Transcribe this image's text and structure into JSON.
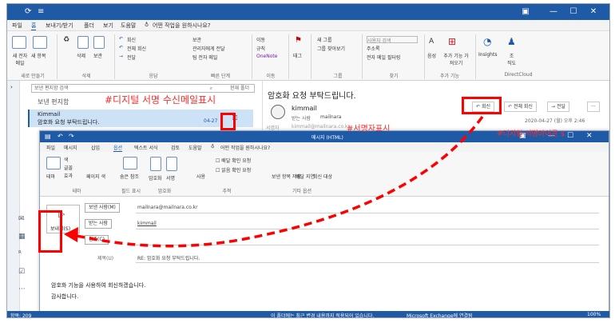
{
  "main": {
    "menus": [
      "파일",
      "홈",
      "보내기/받기",
      "폴더",
      "보기",
      "도움말",
      "어떤 작업을 원하시나요?"
    ],
    "ribbon": {
      "new_mail": "새 전자 메일",
      "new_items": "새 항목",
      "delete": "삭제",
      "archive": "보관",
      "reply": "회신",
      "reply_all": "전체 회신",
      "forward": "전달",
      "forward_to_manager": "관리자에게 전달",
      "team_email": "팀 전자 메일",
      "report": "보관",
      "move": "이동",
      "rules": "규칙",
      "onenote": "OneNote",
      "tag": "태그",
      "new_group": "새 그룹",
      "browse_groups": "그룹 찾아보기",
      "search_people": "사용자 검색",
      "address_book": "주소록",
      "filter_email": "전자 메일 필터링",
      "read_aloud": "음성",
      "get_addins": "추가 기능 가져오기",
      "insights": "Insights",
      "jido": "조\n직도",
      "group_new": "새로 만들기",
      "group_delete": "삭제",
      "group_respond": "응답",
      "group_quick": "빠른 단계",
      "group_move": "이동",
      "group_group": "그룹",
      "group_find": "찾기",
      "group_addins": "추가 기능",
      "group_directcloud": "DirectCloud"
    },
    "folder_tab": "보낸 편지함",
    "search_placeholder": "보낸 편지함 검색",
    "search_scope": "현재 폴더",
    "list": {
      "sender": "Kimmail",
      "subject": "암호화 요청 부탁드립니다.",
      "date": "04-27"
    },
    "reading": {
      "subject": "암호화 요청 부탁드립니다.",
      "sender": "kimmail",
      "recipient_label": "받는 사람",
      "recipient": "mailnara",
      "signer_label": "서명자",
      "signer": "kimmail@mailnara.co.kr",
      "reply": "회신",
      "reply_all": "전체 회신",
      "forward": "전달",
      "more": "···",
      "datetime": "2020-04-27 (월) 오후 2:46"
    },
    "status_left": "항목: 209"
  },
  "annotations": {
    "digital_sign_received": "#디지털 서명 수신메일표시",
    "signer_mark": "#서명자표시",
    "digital_sign_icon": "#디지털 서명아이콘 $"
  },
  "compose": {
    "title": "메시지 (HTML)",
    "menus": [
      "파일",
      "메시지",
      "삽입",
      "옵션",
      "텍스트 서식",
      "검토",
      "도움말",
      "어떤 작업을 원하시나요?"
    ],
    "ribbon": {
      "theme": "테마",
      "colors": "색",
      "fonts": "글꼴",
      "effects": "효과",
      "page_color": "페이지 색",
      "bcc": "숨은 참조",
      "encrypt": "암호화",
      "sign": "서명",
      "use_voting": "사용",
      "delivery_receipt": "배달 확인 요청",
      "read_receipt": "읽음 확인 요청",
      "save_sent": "보낸 항목 저장",
      "delay": "배달 지연",
      "direct_replies": "회신 대상",
      "group_theme": "테마",
      "group_fields": "필드 표시",
      "group_encrypt": "암호화",
      "group_tracking": "추적",
      "group_more": "기타 옵션"
    },
    "send": "보내기(S)",
    "from_label": "보낸 사람(M)",
    "from_value": "mailnara@mailnara.co.kr",
    "to_label": "받는 사람",
    "to_value": "kimmail",
    "cc_label": "참조(C)",
    "subject_label": "제목(U)",
    "subject_value": "RE: 암호화 요청 부탁드립니다.",
    "body_line1": "암호화 기능을 사용하여 회신하겠습니다.",
    "body_line2": "감사합니다.",
    "status_center": "이 폴더에는 최근 변경 내용까지 적용되어 있습니다.",
    "status_exchange": "Microsoft Exchange에 연결됨",
    "zoom": "100%"
  },
  "colors": {
    "accent": "#1f5aa6",
    "annotation_red": "#ff0000"
  }
}
